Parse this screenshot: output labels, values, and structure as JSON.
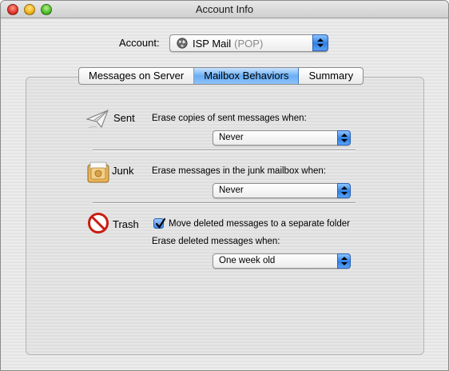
{
  "window": {
    "title": "Account Info"
  },
  "account": {
    "label": "Account:",
    "name": "ISP Mail",
    "type": "(POP)"
  },
  "tabs": [
    {
      "label": "Messages on Server",
      "active": false
    },
    {
      "label": "Mailbox Behaviors",
      "active": true
    },
    {
      "label": "Summary",
      "active": false
    }
  ],
  "sections": {
    "sent": {
      "label": "Sent",
      "description": "Erase copies of sent messages when:",
      "value": "Never"
    },
    "junk": {
      "label": "Junk",
      "description": "Erase messages in the junk mailbox when:",
      "value": "Never"
    },
    "trash": {
      "label": "Trash",
      "checkbox_label": "Move deleted messages to a separate folder",
      "checkbox_checked": true,
      "description": "Erase deleted messages when:",
      "value": "One week old"
    }
  },
  "colors": {
    "accent": "#3e86e6",
    "tab_active": "#6aaef5"
  },
  "icons": {
    "sent": "paper-plane-icon",
    "junk": "junk-mailbox-icon",
    "trash": "no-entry-icon",
    "account": "globe-icon"
  }
}
